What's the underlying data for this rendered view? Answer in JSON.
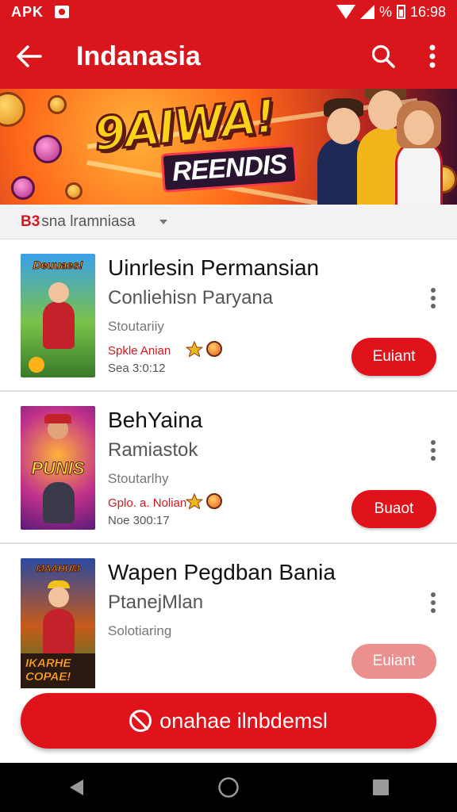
{
  "status_bar": {
    "left_label": "APK",
    "battery_text": "%",
    "time": "16:98"
  },
  "app_bar": {
    "title": "Indanasia"
  },
  "banner": {
    "title": "9AIWA!",
    "subtitle": "REENDIS"
  },
  "filter": {
    "tag": "B3",
    "label": "sna lramniasa"
  },
  "items": [
    {
      "title": "Uinrlesin Permansian",
      "subtitle": "Conliehisn  Paryana",
      "category": "Stoutariiy",
      "size": "Spkle Anian",
      "date": "Sea 3:0:12",
      "button": "Euiant",
      "thumb_text": "Deuuaes!"
    },
    {
      "title": "BehYaina",
      "subtitle": "Ramiastok",
      "category": "Stoutarlhy",
      "size": "Gplo. a. Nolian",
      "date": "Noe 300:17",
      "button": "Buaot",
      "thumb_text": "PUNIS"
    },
    {
      "title": "Wapen Pegdban Bania",
      "subtitle": "PtanejMlan",
      "category": "Solotiaring",
      "button": "",
      "thumb_text": "MAAHUM"
    }
  ],
  "partial": {
    "thumb_text_1": "IKARHE",
    "thumb_text_2": "COPAE!",
    "button": "Euiant"
  },
  "install_bar": {
    "label": "onahae ilnbdemsl"
  },
  "colors": {
    "primary": "#d9161c",
    "button": "#e0121a"
  }
}
